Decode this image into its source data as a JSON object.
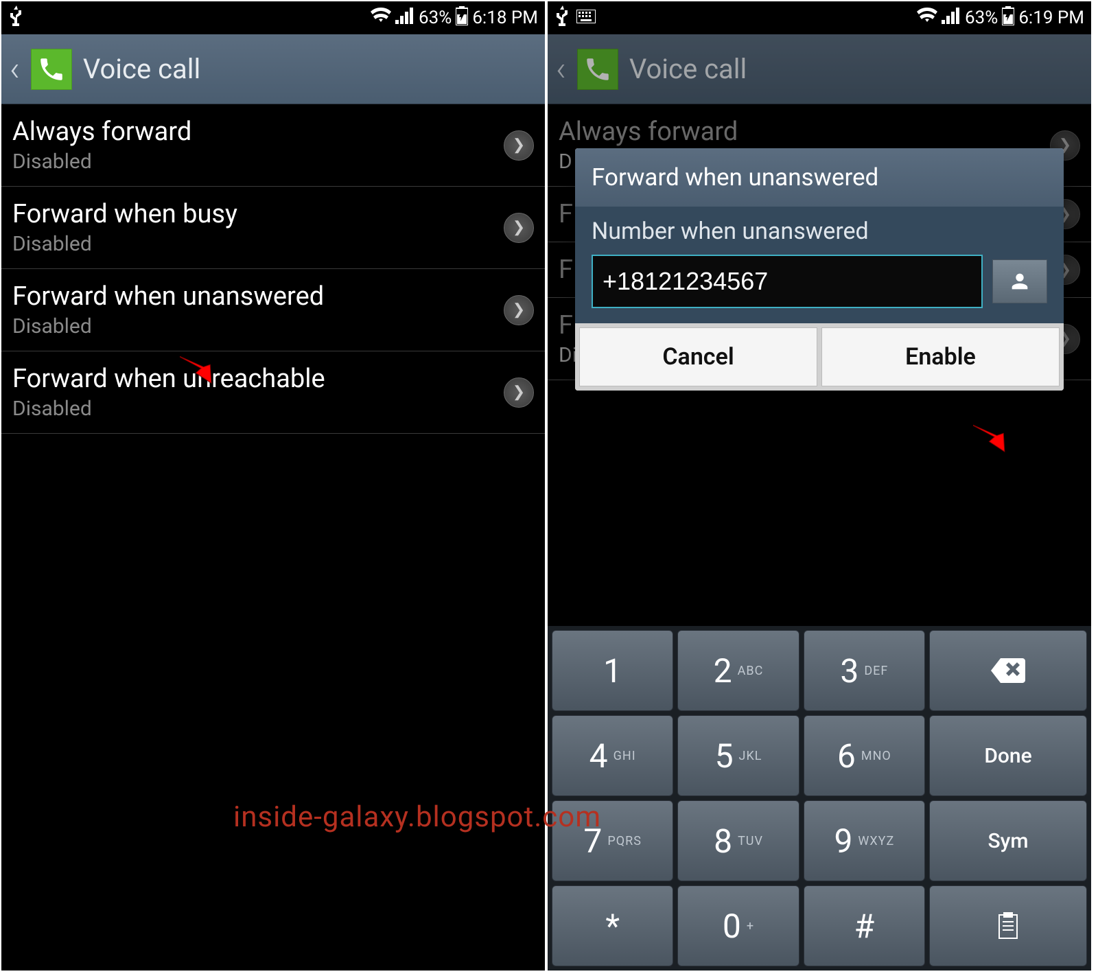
{
  "left": {
    "status": {
      "battery": "63%",
      "time": "6:18 PM"
    },
    "header": {
      "title": "Voice call"
    },
    "items": [
      {
        "title": "Always forward",
        "sub": "Disabled"
      },
      {
        "title": "Forward when busy",
        "sub": "Disabled"
      },
      {
        "title": "Forward when unanswered",
        "sub": "Disabled"
      },
      {
        "title": "Forward when unreachable",
        "sub": "Disabled"
      }
    ]
  },
  "right": {
    "status": {
      "battery": "63%",
      "time": "6:19 PM"
    },
    "header": {
      "title": "Voice call"
    },
    "items": [
      {
        "title": "Always forward",
        "sub": "D"
      },
      {
        "title": "F",
        "sub": ""
      },
      {
        "title": "F",
        "sub": ""
      },
      {
        "title": "F",
        "sub": "Disabled"
      }
    ],
    "dialog": {
      "title": "Forward when unanswered",
      "label": "Number when unanswered",
      "value": "+18121234567",
      "cancel": "Cancel",
      "enable": "Enable"
    },
    "keypad": {
      "rows": [
        [
          {
            "d": "1",
            "s": ""
          },
          {
            "d": "2",
            "s": "ABC"
          },
          {
            "d": "3",
            "s": "DEF"
          },
          {
            "action": "backspace"
          }
        ],
        [
          {
            "d": "4",
            "s": "GHI"
          },
          {
            "d": "5",
            "s": "JKL"
          },
          {
            "d": "6",
            "s": "MNO"
          },
          {
            "action": "Done"
          }
        ],
        [
          {
            "d": "7",
            "s": "PQRS"
          },
          {
            "d": "8",
            "s": "TUV"
          },
          {
            "d": "9",
            "s": "WXYZ"
          },
          {
            "action": "Sym"
          }
        ],
        [
          {
            "d": "*",
            "s": ""
          },
          {
            "d": "0",
            "s": "+"
          },
          {
            "d": "#",
            "s": ""
          },
          {
            "action": "clipboard"
          }
        ]
      ]
    }
  },
  "watermark": "inside-galaxy.blogspot.com"
}
